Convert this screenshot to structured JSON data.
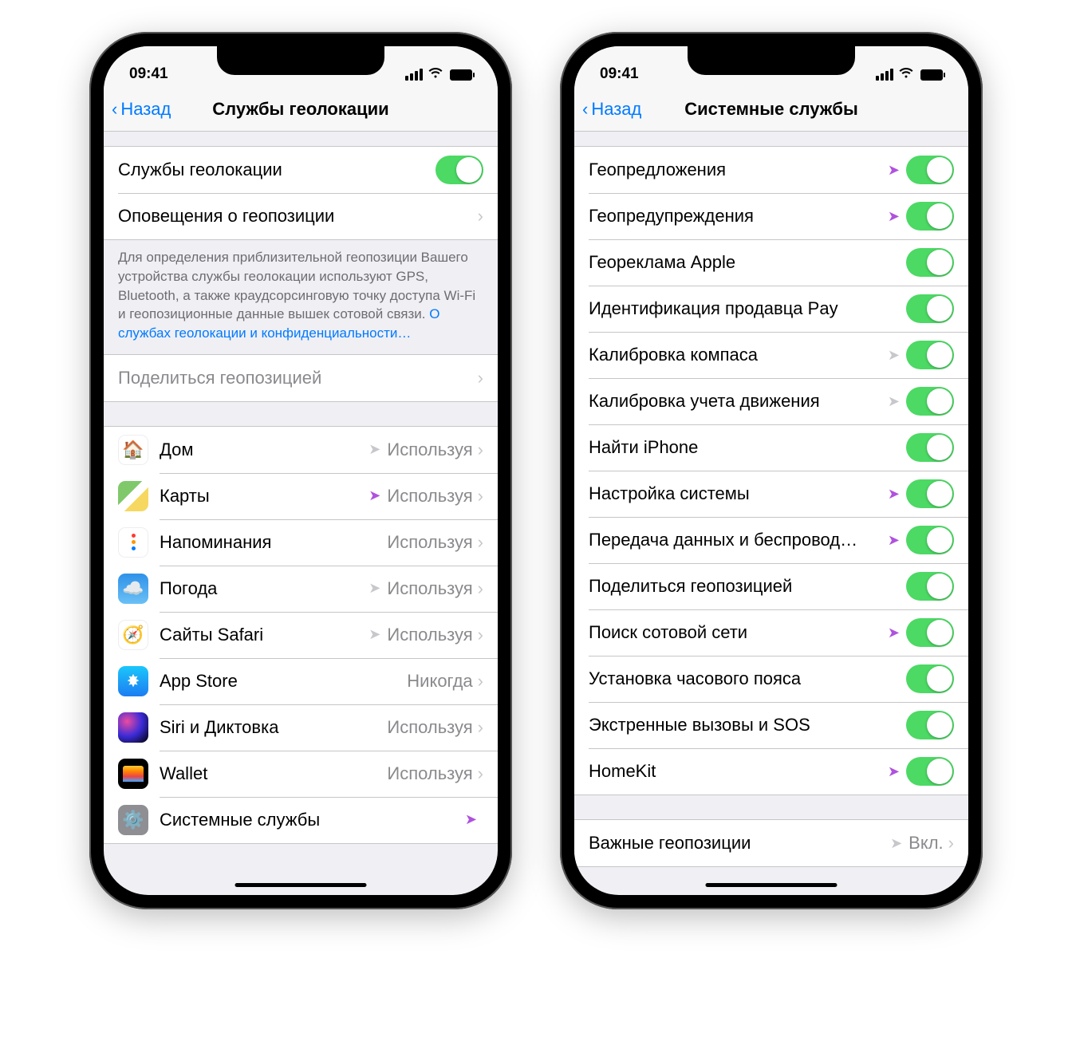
{
  "status": {
    "time": "09:41"
  },
  "left": {
    "back": "Назад",
    "title": "Службы геолокации",
    "main_toggle_label": "Службы геолокации",
    "alerts_label": "Оповещения о геопозиции",
    "footer_text": "Для определения приблизительной геопозиции Вашего устройства службы геолокации используют GPS, Bluetooth, а также краудсорсинговую точку доступа Wi-Fi и геопозиционные данные вышек сотовой связи. ",
    "footer_link": "О службах геолокации и конфиденциальности…",
    "share_label": "Поделиться геопозицией",
    "apps": [
      {
        "name": "Дом",
        "status": "Используя",
        "arrow": "gray",
        "icon": "home"
      },
      {
        "name": "Карты",
        "status": "Используя",
        "arrow": "purple",
        "icon": "maps"
      },
      {
        "name": "Напоминания",
        "status": "Используя",
        "arrow": "",
        "icon": "reminders"
      },
      {
        "name": "Погода",
        "status": "Используя",
        "arrow": "gray",
        "icon": "weather"
      },
      {
        "name": "Сайты Safari",
        "status": "Используя",
        "arrow": "gray",
        "icon": "safari"
      },
      {
        "name": "App Store",
        "status": "Никогда",
        "arrow": "",
        "icon": "appstore"
      },
      {
        "name": "Siri и Диктовка",
        "status": "Используя",
        "arrow": "",
        "icon": "siri"
      },
      {
        "name": "Wallet",
        "status": "Используя",
        "arrow": "",
        "icon": "wallet"
      },
      {
        "name": "Системные службы",
        "status": "",
        "arrow": "purple",
        "icon": "system"
      }
    ]
  },
  "right": {
    "back": "Назад",
    "title": "Системные службы",
    "items": [
      {
        "label": "Геопредложения",
        "arrow": "purple",
        "toggle": true
      },
      {
        "label": "Геопредупреждения",
        "arrow": "purple",
        "toggle": true
      },
      {
        "label": "Геореклама Apple",
        "arrow": "",
        "toggle": true
      },
      {
        "label": "Идентификация продавца Pay",
        "arrow": "",
        "toggle": true
      },
      {
        "label": "Калибровка компаса",
        "arrow": "gray",
        "toggle": true
      },
      {
        "label": "Калибровка учета движения",
        "arrow": "gray",
        "toggle": true
      },
      {
        "label": "Найти iPhone",
        "arrow": "",
        "toggle": true
      },
      {
        "label": "Настройка системы",
        "arrow": "purple",
        "toggle": true
      },
      {
        "label": "Передача данных и беспровод…",
        "arrow": "purple",
        "toggle": true
      },
      {
        "label": "Поделиться геопозицией",
        "arrow": "",
        "toggle": true
      },
      {
        "label": "Поиск сотовой сети",
        "arrow": "purple",
        "toggle": true
      },
      {
        "label": "Установка часового пояса",
        "arrow": "",
        "toggle": true
      },
      {
        "label": "Экстренные вызовы и SOS",
        "arrow": "",
        "toggle": true
      },
      {
        "label": "HomeKit",
        "arrow": "purple",
        "toggle": true
      }
    ],
    "significant": {
      "label": "Важные геопозиции",
      "value": "Вкл.",
      "arrow": "gray"
    }
  }
}
